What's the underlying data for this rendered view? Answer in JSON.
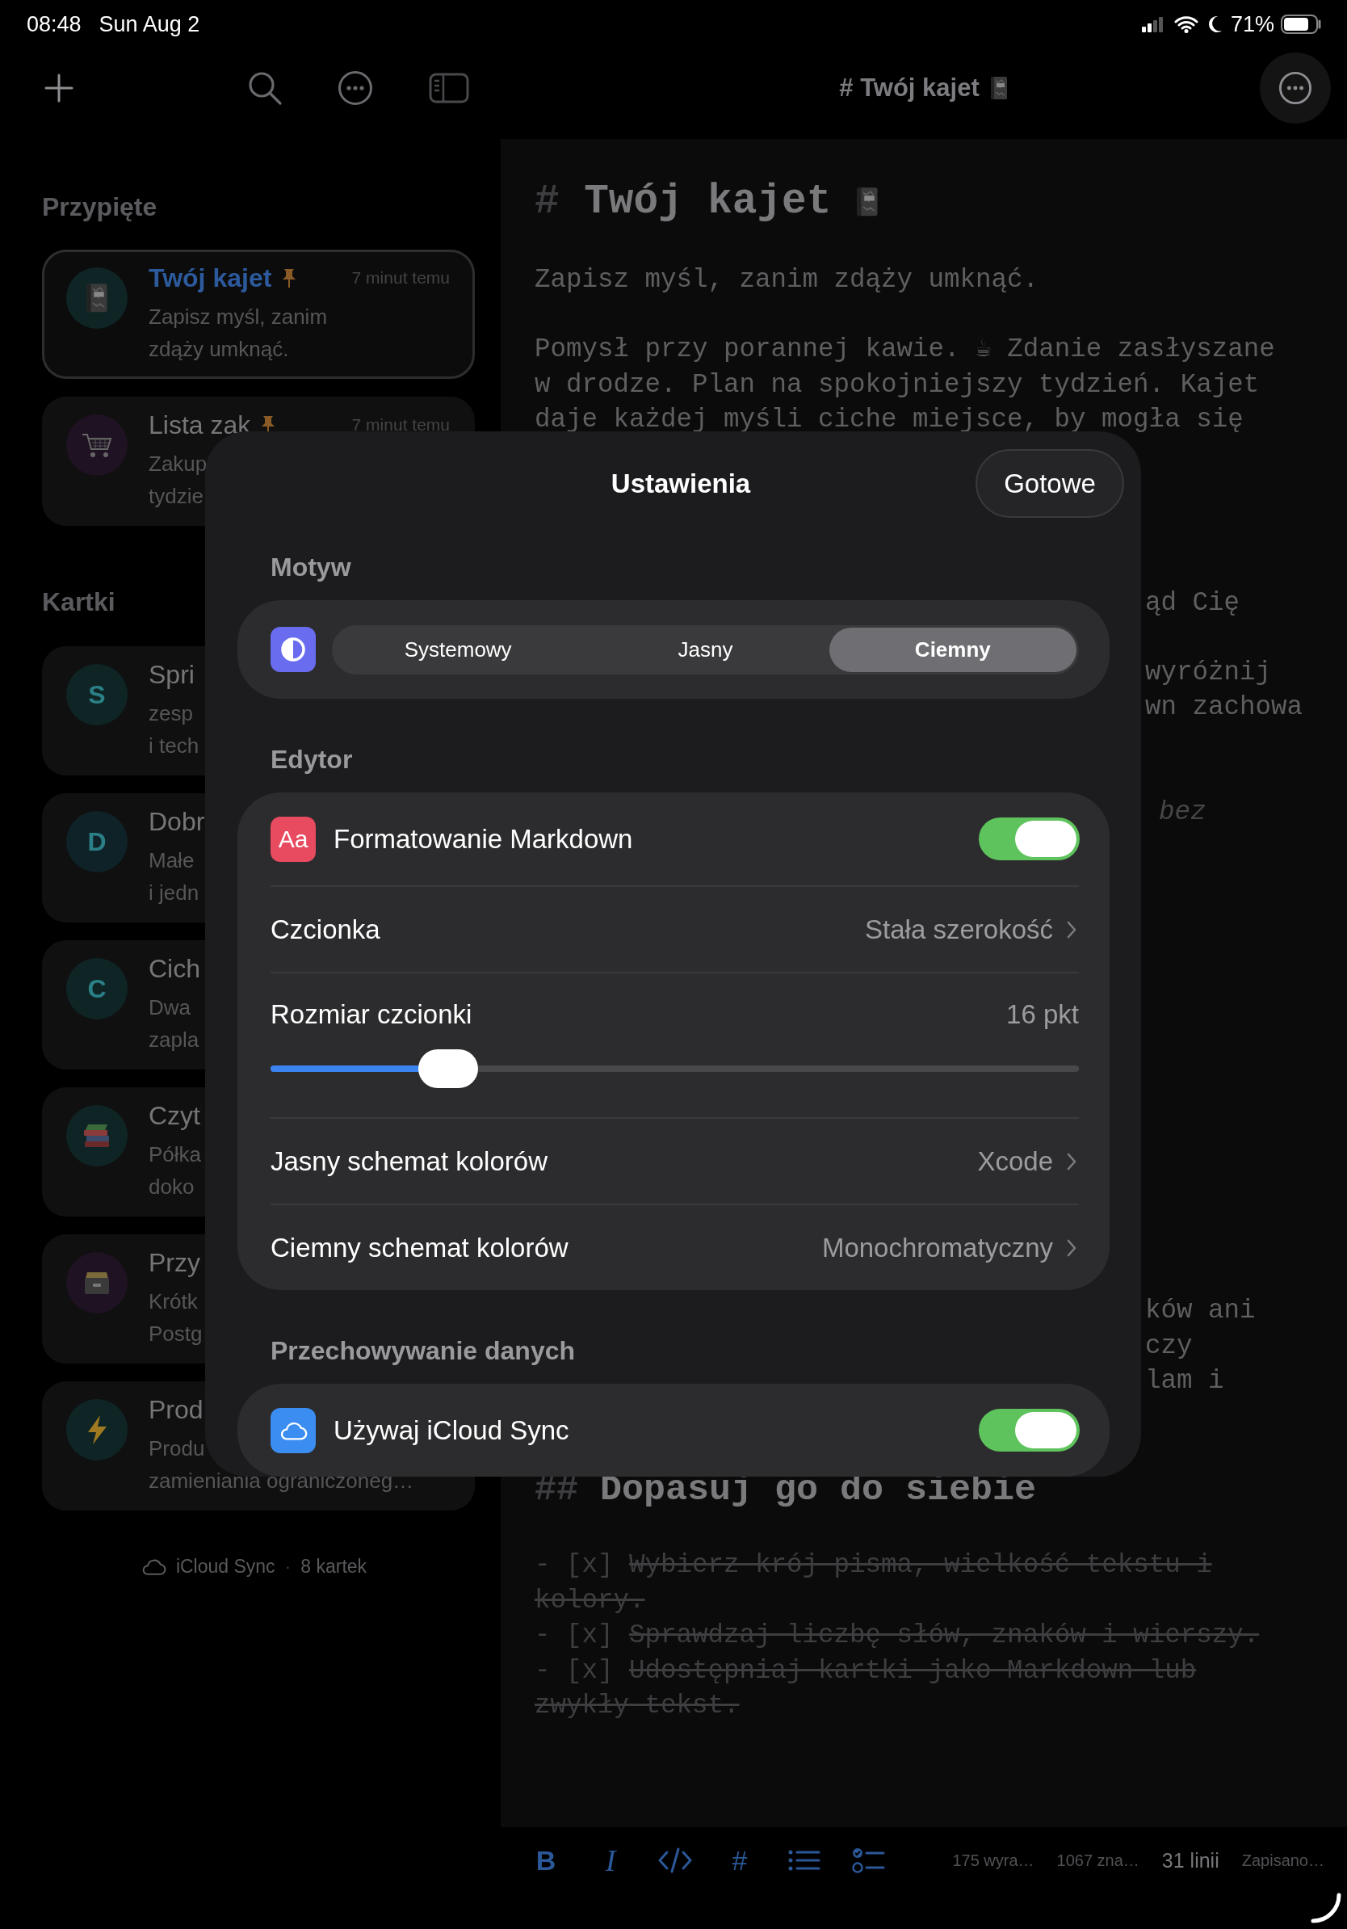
{
  "status_bar": {
    "time": "08:48",
    "date": "Sun Aug 2",
    "battery": "71%"
  },
  "toolbar": {
    "title": "# Twój kajet"
  },
  "sidebar": {
    "sections": [
      {
        "title": "Przypięte",
        "notes": [
          {
            "avatar": {
              "kind": "notebook",
              "color": "#0f2525"
            },
            "title": "Twój kajet",
            "pinned": true,
            "time": "7 minut temu",
            "preview": [
              "Zapisz myśl, zanim",
              "zdąży umknąć."
            ],
            "selected": true
          },
          {
            "avatar": {
              "kind": "cart",
              "color": "#1f1222"
            },
            "title": "Lista zak",
            "pinned": true,
            "time": "7 minut temu",
            "preview": [
              "Zakup",
              "tydzie"
            ],
            "selected": false
          }
        ]
      },
      {
        "title": "Kartki",
        "notes": [
          {
            "avatar": {
              "kind": "letter",
              "letter": "S",
              "color": "#0f2525"
            },
            "title": "Spri",
            "pinned": false,
            "preview": [
              "zesp",
              "i tech"
            ],
            "selected": false
          },
          {
            "avatar": {
              "kind": "letter",
              "letter": "D",
              "color": "#0f2228"
            },
            "title": "Dobr",
            "pinned": false,
            "preview": [
              "Małe",
              "i jedn"
            ],
            "selected": false
          },
          {
            "avatar": {
              "kind": "letter",
              "letter": "C",
              "color": "#0f2525"
            },
            "title": "Cich",
            "pinned": false,
            "preview": [
              "Dwa",
              "zapla"
            ],
            "selected": false
          },
          {
            "avatar": {
              "kind": "books",
              "color": "#0f2525"
            },
            "title": "Czyt",
            "pinned": false,
            "preview": [
              "Półka",
              "doko"
            ],
            "selected": false
          },
          {
            "avatar": {
              "kind": "filebox",
              "color": "#1f1222"
            },
            "title": "Przy",
            "pinned": false,
            "preview": [
              "Krótk",
              "Postg"
            ],
            "selected": false
          },
          {
            "avatar": {
              "kind": "bolt",
              "color": "#0f2525"
            },
            "title": "Prod",
            "pinned": false,
            "preview": [
              "Produ",
              "zamieniania ograniczoneg…"
            ],
            "selected": false
          }
        ]
      }
    ],
    "footer": {
      "sync": "iCloud Sync",
      "separator": "·",
      "count": "8 kartek"
    }
  },
  "editor": {
    "blocks": [
      {
        "kind": "h1",
        "marker": "#",
        "text": "Twój kajet"
      },
      {
        "kind": "paragraph",
        "lines": [
          "Zapisz myśl, zanim zdąży umknąć."
        ]
      },
      {
        "kind": "paragraph",
        "lines": [
          "Pomysł przy porannej kawie. ☕ Zdanie zasłyszane",
          "w drodze. Plan na spokojniejszy tydzień. Kajet",
          "daje każdej myśli ciche miejsce, by mogła się"
        ]
      },
      {
        "kind": "fragment",
        "lines": [
          "ąd Cię"
        ]
      },
      {
        "kind": "fragment",
        "lines": [
          "wyróżnij",
          "wn zachowa"
        ]
      },
      {
        "kind": "fragment_italic",
        "lines": [
          "bez"
        ]
      },
      {
        "kind": "fragment",
        "lines": [
          "ków ani",
          "czy",
          "lam i"
        ]
      },
      {
        "kind": "h2",
        "marker": "##",
        "text": "Dopasuj go do siebie"
      },
      {
        "kind": "tasks",
        "items": [
          {
            "marker": "- [x]",
            "checked": true,
            "lines": [
              "Wybierz krój pisma, wielkość tekstu i",
              "kolory."
            ]
          },
          {
            "marker": "- [x]",
            "checked": true,
            "lines": [
              "Sprawdzaj liczbę słów, znaków i wierszy."
            ]
          },
          {
            "marker": "- [x]",
            "checked": true,
            "lines": [
              "Udostępniaj kartki jako Markdown lub",
              "zwykły tekst."
            ]
          }
        ]
      }
    ]
  },
  "format_bar": {
    "buttons": [
      {
        "kind": "bold",
        "label": "B"
      },
      {
        "kind": "italic",
        "label": "I"
      },
      {
        "kind": "code"
      },
      {
        "kind": "heading",
        "label": "#"
      },
      {
        "kind": "list"
      },
      {
        "kind": "checklist"
      }
    ],
    "stats": [
      {
        "text": "175 wyra…",
        "highlighted": false
      },
      {
        "text": "1067 zna…",
        "highlighted": false
      },
      {
        "text": "31 linii",
        "highlighted": true
      },
      {
        "text": "Zapisano…",
        "highlighted": false
      }
    ]
  },
  "settings": {
    "title": "Ustawienia",
    "done": "Gotowe",
    "sections": [
      {
        "header": "Motyw",
        "rows": [
          {
            "kind": "segmented",
            "options": [
              {
                "label": "Systemowy",
                "selected": false
              },
              {
                "label": "Jasny",
                "selected": false
              },
              {
                "label": "Ciemny",
                "selected": true
              }
            ]
          }
        ]
      },
      {
        "header": "Edytor",
        "rows": [
          {
            "kind": "toggle",
            "icon_text": "Aa",
            "label": "Formatowanie Markdown",
            "on": true
          },
          {
            "kind": "link",
            "label": "Czcionka",
            "value": "Stała szerokość"
          },
          {
            "kind": "slider",
            "label": "Rozmiar czcionki",
            "value": "16 pkt",
            "level": 0.22
          },
          {
            "kind": "link",
            "label": "Jasny schemat kolorów",
            "value": "Xcode"
          },
          {
            "kind": "link",
            "label": "Ciemny schemat kolorów",
            "value": "Monochromatyczny"
          }
        ]
      },
      {
        "header": "Przechowywanie danych",
        "rows": [
          {
            "kind": "toggle",
            "label": "Używaj iCloud Sync",
            "on": true
          }
        ]
      }
    ]
  }
}
